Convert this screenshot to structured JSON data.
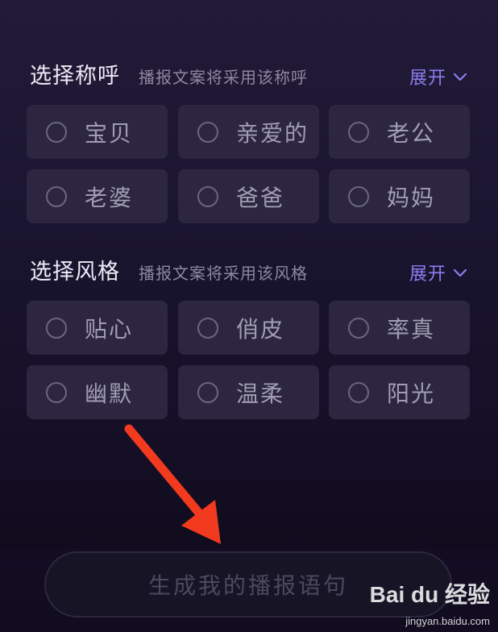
{
  "address_section": {
    "title": "选择称呼",
    "subtitle": "播报文案将采用该称呼",
    "expand_label": "展开",
    "options": [
      {
        "label": "宝贝"
      },
      {
        "label": "亲爱的"
      },
      {
        "label": "老公"
      },
      {
        "label": "老婆"
      },
      {
        "label": "爸爸"
      },
      {
        "label": "妈妈"
      }
    ]
  },
  "style_section": {
    "title": "选择风格",
    "subtitle": "播报文案将采用该风格",
    "expand_label": "展开",
    "options": [
      {
        "label": "贴心"
      },
      {
        "label": "俏皮"
      },
      {
        "label": "率真"
      },
      {
        "label": "幽默"
      },
      {
        "label": "温柔"
      },
      {
        "label": "阳光"
      }
    ]
  },
  "generate_button": {
    "label": "生成我的播报语句"
  },
  "watermark": {
    "logo": "Bai du 经验",
    "url": "jingyan.baidu.com"
  },
  "icons": {
    "expand": "chevron-down-icon",
    "radio": "radio-unchecked-icon",
    "annotation": "red-arrow-icon"
  },
  "colors": {
    "accent": "#8d7df0",
    "annotation": "#f23a1f",
    "option_bg": "#2c2641"
  }
}
